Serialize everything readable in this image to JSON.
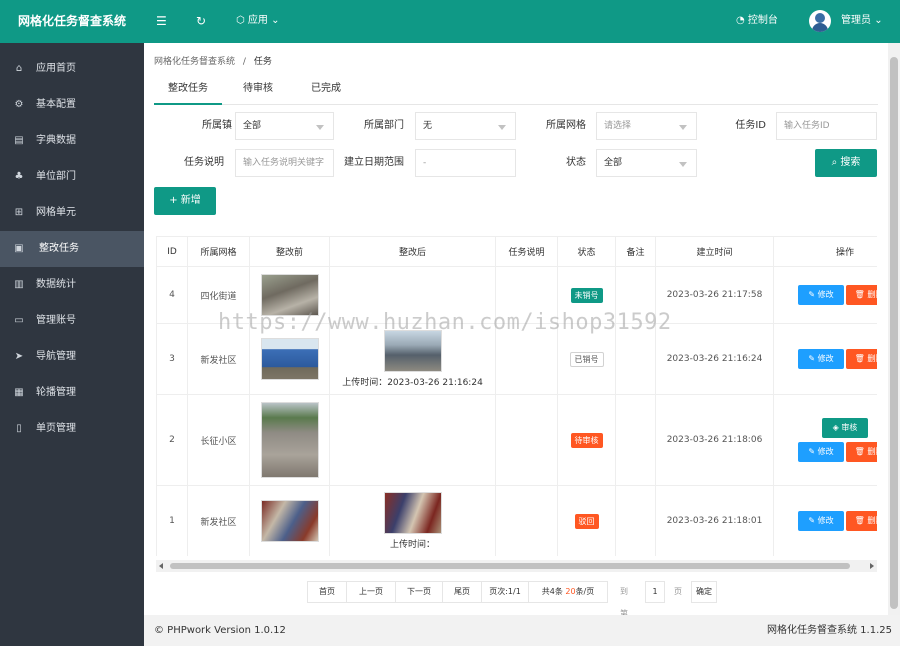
{
  "app": {
    "title": "网格化任务督查系统"
  },
  "header": {
    "menu_icon": "☰",
    "refresh_icon": "↻",
    "app_menu": "应用",
    "console": "控制台",
    "user": "管理员"
  },
  "sidebar": {
    "items": [
      {
        "label": "应用首页",
        "icon": "home-icon"
      },
      {
        "label": "基本配置",
        "icon": "gear-icon"
      },
      {
        "label": "字典数据",
        "icon": "book-icon"
      },
      {
        "label": "单位部门",
        "icon": "org-icon"
      },
      {
        "label": "网格单元",
        "icon": "grid-icon"
      },
      {
        "label": "整改任务",
        "icon": "image-icon",
        "active": true
      },
      {
        "label": "数据统计",
        "icon": "chart-icon"
      },
      {
        "label": "管理账号",
        "icon": "account-icon"
      },
      {
        "label": "导航管理",
        "icon": "send-icon"
      },
      {
        "label": "轮播管理",
        "icon": "carousel-icon"
      },
      {
        "label": "单页管理",
        "icon": "page-icon"
      }
    ]
  },
  "breadcrumb": {
    "root": "网格化任务督查系统",
    "sep": "/",
    "current": "任务"
  },
  "tabs": [
    "整改任务",
    "待审核",
    "已完成"
  ],
  "filters": {
    "town_label": "所属镇",
    "town_value": "全部",
    "dept_label": "所属部门",
    "dept_value": "无",
    "grid_label": "所属网格",
    "grid_placeholder": "请选择",
    "task_id_label": "任务ID",
    "task_id_placeholder": "输入任务ID",
    "desc_label": "任务说明",
    "desc_placeholder": "输入任务说明关键字",
    "date_label": "建立日期范围",
    "date_placeholder": "-",
    "status_label": "状态",
    "status_value": "全部",
    "search_button": "搜索",
    "add_button": "新增"
  },
  "table": {
    "headers": [
      "ID",
      "所属网格",
      "整改前",
      "整改后",
      "任务说明",
      "状态",
      "备注",
      "建立时间",
      "操作"
    ],
    "rows": [
      {
        "id": "4",
        "grid": "四化街道",
        "after_time": "",
        "status": "未销号",
        "status_style": "green",
        "created": "2023-03-26 21:17:58",
        "review": ""
      },
      {
        "id": "3",
        "grid": "新发社区",
        "after_time": "上传时间：2023-03-26 21:16:24",
        "status": "已销号",
        "status_style": "white",
        "created": "2023-03-26 21:16:24",
        "review": ""
      },
      {
        "id": "2",
        "grid": "长征小区",
        "after_time": "",
        "status": "待审核",
        "status_style": "orange",
        "created": "2023-03-26 21:18:06",
        "review": "审核"
      },
      {
        "id": "1",
        "grid": "新发社区",
        "after_time": "上传时间：",
        "status": "驳回",
        "status_style": "orange",
        "created": "2023-03-26 21:18:01",
        "review": ""
      }
    ],
    "edit_label": "修改",
    "delete_label": "删除"
  },
  "pager": {
    "first": "首页",
    "prev": "上一页",
    "next": "下一页",
    "last": "尾页",
    "page_info_prefix": "页次:",
    "page_info_value": "1/1",
    "total_prefix": "共4条 ",
    "per_page": "20",
    "total_suffix": "条/页",
    "goto_label": "到第",
    "goto_value": "1",
    "page_unit": "页",
    "confirm": "确定"
  },
  "footer": {
    "copyright": "© PHPwork Version 1.0.12",
    "system": "网格化任务督查系统 1.1.25"
  },
  "watermark": "https://www.huzhan.com/ishop31592"
}
